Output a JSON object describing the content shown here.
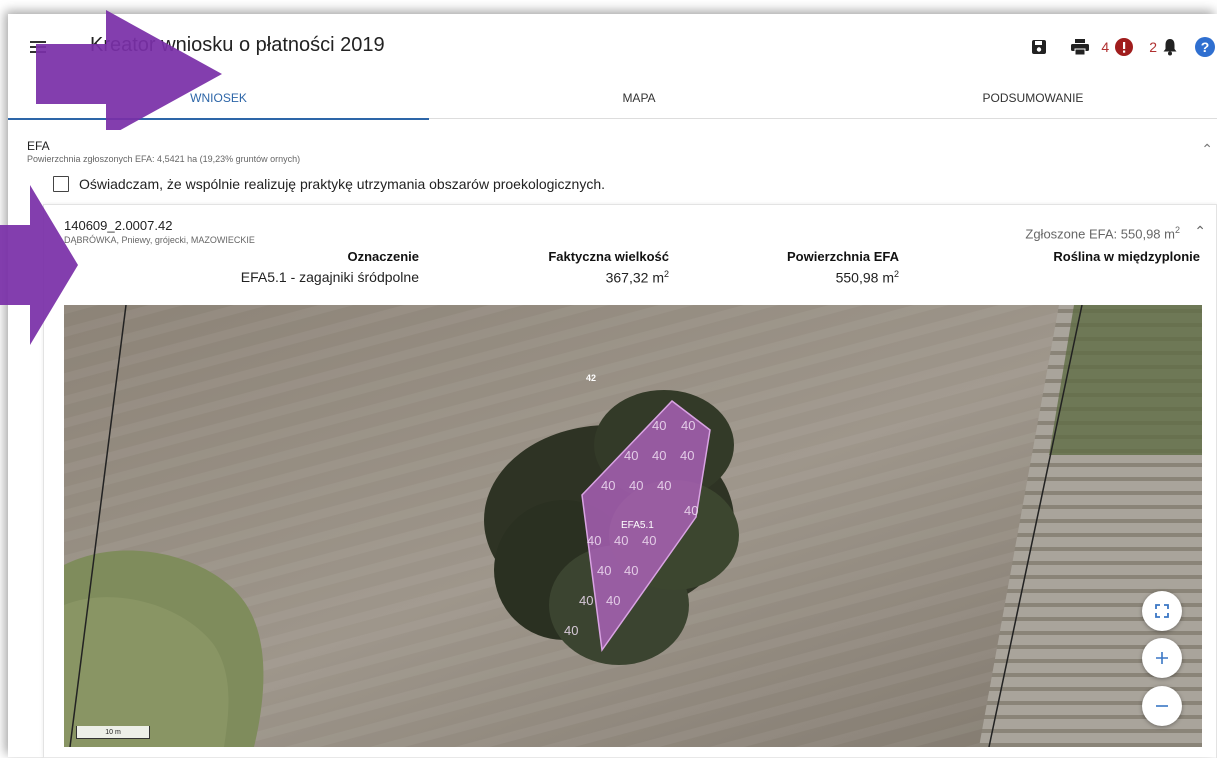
{
  "app": {
    "title": "Kreator wniosku o płatności 2019",
    "counts": {
      "errors": "4",
      "notifications": "2"
    },
    "icons": [
      "menu-icon",
      "save-icon",
      "print-icon",
      "error-icon",
      "bell-icon",
      "help-icon"
    ]
  },
  "tabs": [
    {
      "label": "WNIOSEK",
      "active": true
    },
    {
      "label": "MAPA",
      "active": false
    },
    {
      "label": "PODSUMOWANIE",
      "active": false
    }
  ],
  "efa": {
    "title": "EFA",
    "summary": "Powierzchnia zgłoszonych EFA: 4,5421 ha (19,23% gruntów ornych)",
    "declaration": "Oświadczam, że wspólnie realizuję praktykę utrzymania obszarów proekologicznych."
  },
  "parcel": {
    "id": "140609_2.0007.42",
    "location": "DĄBRÓWKA, Pniewy, grójecki, MAZOWIECKIE",
    "declared_label": "Zgłoszone EFA: 550,98 m",
    "declared_sup": "2",
    "columns": {
      "oznaczenie": {
        "header": "Oznaczenie",
        "value": "EFA5.1 - zagajniki śródpolne"
      },
      "wielkosc": {
        "header": "Faktyczna wielkość",
        "value": "367,32 m",
        "sup": "2"
      },
      "powierzchnia": {
        "header": "Powierzchnia EFA",
        "value": "550,98 m",
        "sup": "2"
      },
      "roslina": {
        "header": "Roślina w międzyplonie",
        "value": ""
      }
    }
  },
  "map": {
    "parcel_label": "42",
    "feature_label": "EFA5.1",
    "hatch_symbol": "40",
    "scale_label": "10 m"
  },
  "colors": {
    "accent": "#2d66a8",
    "arrow": "#7a2fa8",
    "polygon": "#b866c8",
    "error_red": "#a01d1d"
  }
}
